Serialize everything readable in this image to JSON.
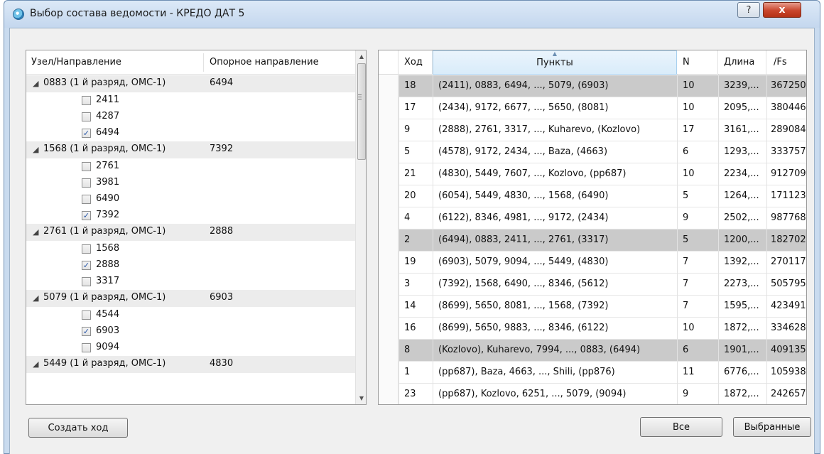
{
  "window": {
    "title": "Выбор состава ведомости - КРЕДО ДАТ 5",
    "help_label": "?",
    "close_label": "x"
  },
  "tree": {
    "col_node": "Узел/Направление",
    "col_ref": "Опорное направление",
    "nodes": [
      {
        "label": "0883 (1 й разряд, ОМС-1)",
        "ref": "6494",
        "children": [
          {
            "label": "2411",
            "checked": false
          },
          {
            "label": "4287",
            "checked": false
          },
          {
            "label": "6494",
            "checked": true
          }
        ]
      },
      {
        "label": "1568 (1 й разряд, ОМС-1)",
        "ref": "7392",
        "children": [
          {
            "label": "2761",
            "checked": false
          },
          {
            "label": "3981",
            "checked": false
          },
          {
            "label": "6490",
            "checked": false
          },
          {
            "label": "7392",
            "checked": true
          }
        ]
      },
      {
        "label": "2761 (1 й разряд, ОМС-1)",
        "ref": "2888",
        "children": [
          {
            "label": "1568",
            "checked": false
          },
          {
            "label": "2888",
            "checked": true
          },
          {
            "label": "3317",
            "checked": false
          }
        ]
      },
      {
        "label": "5079 (1 й разряд, ОМС-1)",
        "ref": "6903",
        "children": [
          {
            "label": "4544",
            "checked": false
          },
          {
            "label": "6903",
            "checked": true
          },
          {
            "label": "9094",
            "checked": false
          }
        ]
      },
      {
        "label": "5449 (1 й разряд, ОМС-1)",
        "ref": "4830",
        "children": []
      }
    ]
  },
  "table": {
    "columns": [
      "Ход",
      "Пункты",
      "N",
      "Длина",
      "/Fs"
    ],
    "sorted_column": "Пункты",
    "rows": [
      {
        "hod": "18",
        "points": "(2411), 0883, 6494, ..., 5079, (6903)",
        "n": "10",
        "len": "3239,...",
        "fs": "367250",
        "selected": true
      },
      {
        "hod": "17",
        "points": "(2434), 9172, 6677, ..., 5650, (8081)",
        "n": "10",
        "len": "2095,...",
        "fs": "380446",
        "selected": false
      },
      {
        "hod": "9",
        "points": "(2888), 2761, 3317, ..., Kuharevo, (Kozlovo)",
        "n": "17",
        "len": "3161,...",
        "fs": "289084",
        "selected": false
      },
      {
        "hod": "5",
        "points": "(4578), 9172, 2434, ..., Baza, (4663)",
        "n": "6",
        "len": "1293,...",
        "fs": "333757",
        "selected": false
      },
      {
        "hod": "21",
        "points": "(4830), 5449, 7607, ..., Kozlovo, (pp687)",
        "n": "10",
        "len": "2234,...",
        "fs": "912709",
        "selected": false
      },
      {
        "hod": "20",
        "points": "(6054), 5449, 4830, ..., 1568, (6490)",
        "n": "5",
        "len": "1264,...",
        "fs": "171123",
        "selected": false
      },
      {
        "hod": "4",
        "points": "(6122), 8346, 4981, ..., 9172, (2434)",
        "n": "9",
        "len": "2502,...",
        "fs": "987768",
        "selected": false
      },
      {
        "hod": "2",
        "points": "(6494), 0883, 2411, ..., 2761, (3317)",
        "n": "5",
        "len": "1200,...",
        "fs": "182702",
        "selected": true
      },
      {
        "hod": "19",
        "points": "(6903), 5079, 9094, ..., 5449, (4830)",
        "n": "7",
        "len": "1392,...",
        "fs": "270117",
        "selected": false
      },
      {
        "hod": "3",
        "points": "(7392), 1568, 6490, ..., 8346, (5612)",
        "n": "7",
        "len": "2273,...",
        "fs": "505795",
        "selected": false
      },
      {
        "hod": "14",
        "points": "(8699), 5650, 8081, ..., 1568, (7392)",
        "n": "7",
        "len": "1595,...",
        "fs": "423491",
        "selected": false
      },
      {
        "hod": "16",
        "points": "(8699), 5650, 9883, ..., 8346, (6122)",
        "n": "10",
        "len": "1872,...",
        "fs": "334628",
        "selected": false
      },
      {
        "hod": "8",
        "points": "(Kozlovo), Kuharevo, 7994, ..., 0883, (6494)",
        "n": "6",
        "len": "1901,...",
        "fs": "409135",
        "selected": true
      },
      {
        "hod": "1",
        "points": "(pp687), Baza, 4663, ..., Shili, (pp876)",
        "n": "11",
        "len": "6776,...",
        "fs": "105938",
        "selected": false
      },
      {
        "hod": "23",
        "points": "(pp687), Kozlovo, 6251, ..., 5079, (9094)",
        "n": "9",
        "len": "1872,...",
        "fs": "242657",
        "selected": false
      }
    ]
  },
  "buttons": {
    "create_route": "Создать ход",
    "all": "Все",
    "selected": "Выбранные"
  },
  "colors": {
    "selected_row": "#cacaca",
    "window_frame": "#c9dbef",
    "close_button": "#c9452c"
  }
}
